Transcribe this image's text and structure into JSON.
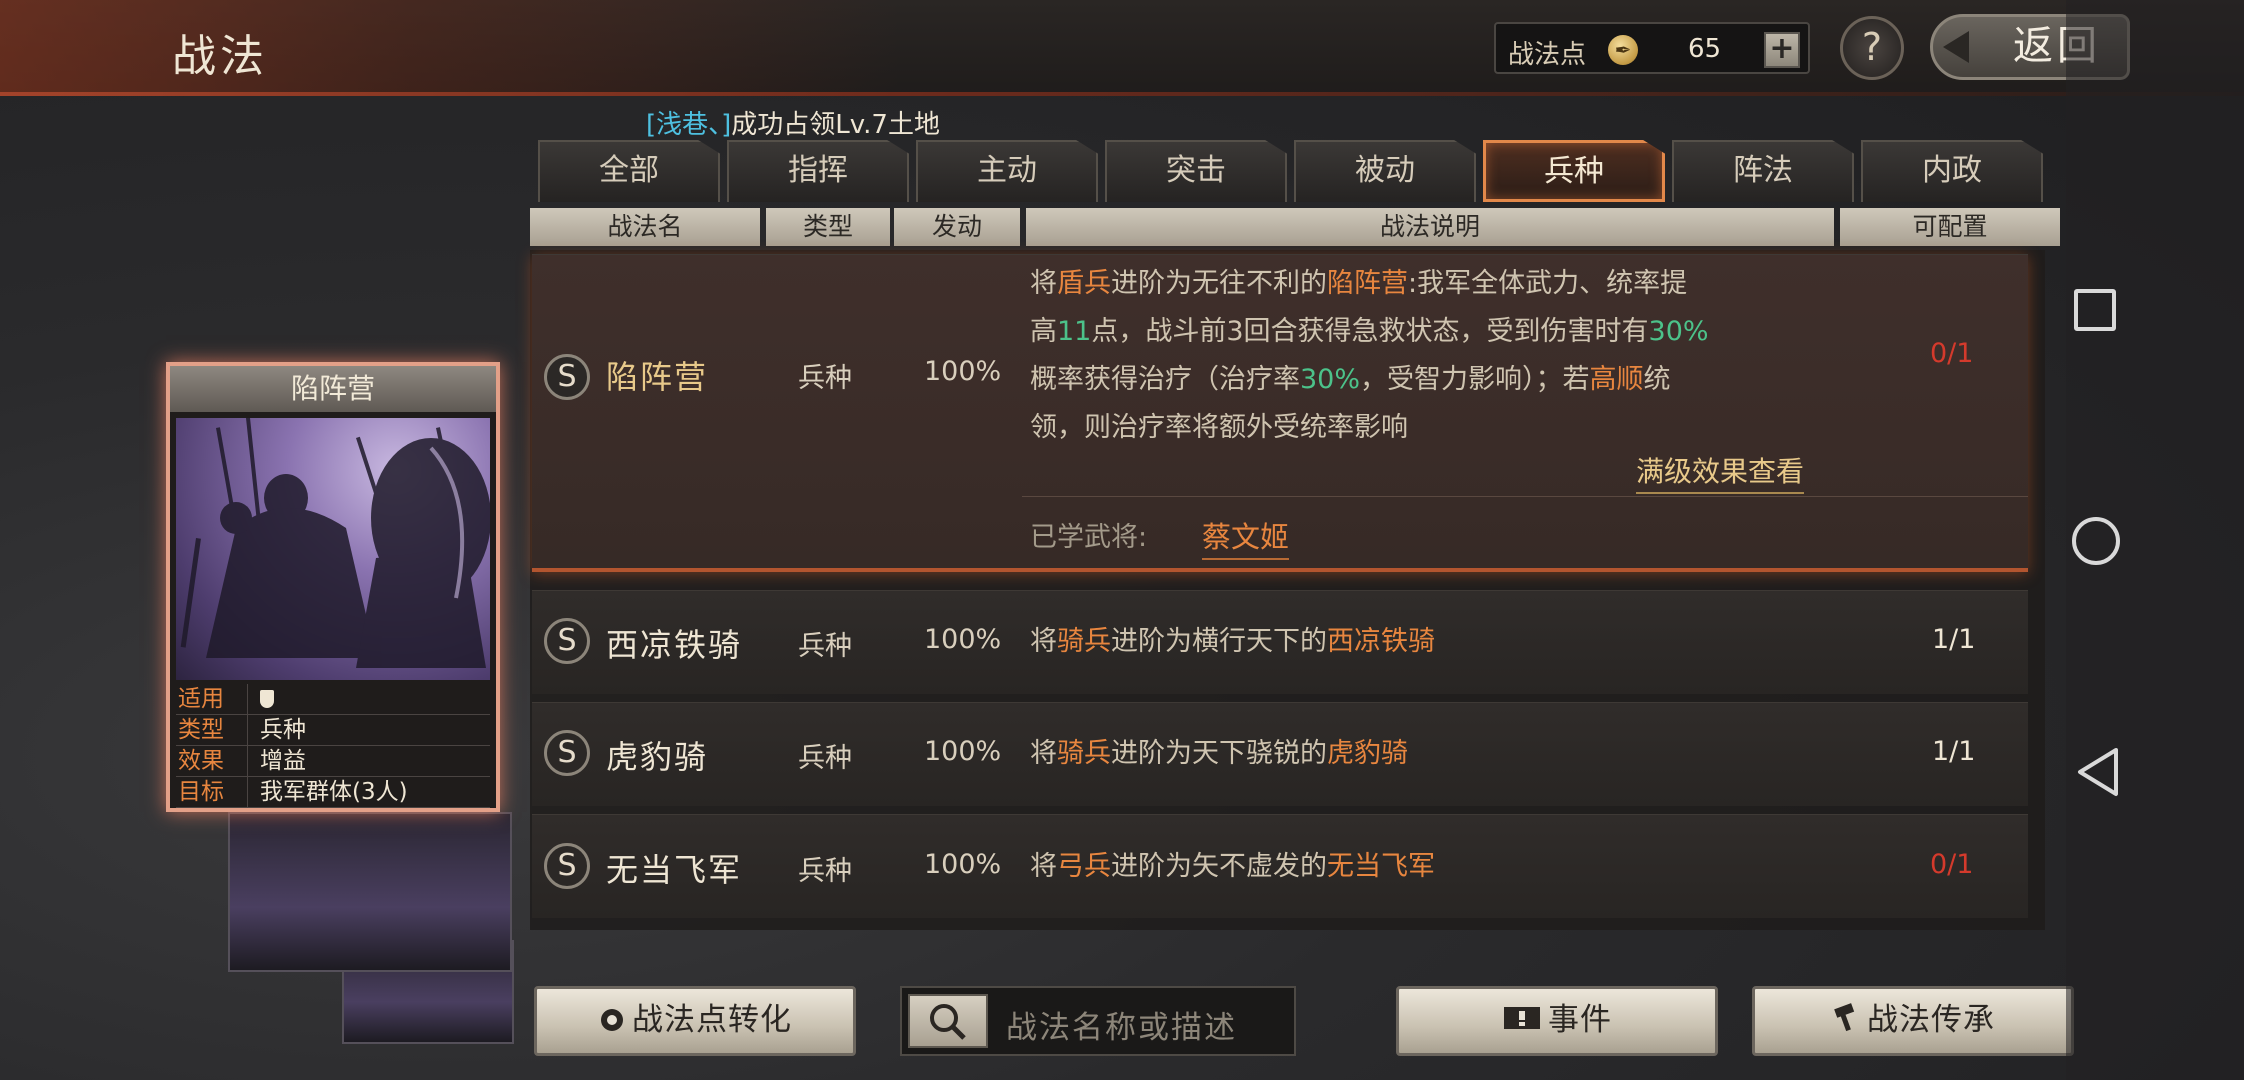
{
  "header": {
    "title": "战法",
    "points_label": "战法点",
    "points_value": "65",
    "plus_label": "+",
    "help_label": "?",
    "back_label": "返回"
  },
  "notice": {
    "who": "[浅巷、]",
    "text": "成功占领Lv.7土地"
  },
  "tabs": [
    {
      "label": "全部"
    },
    {
      "label": "指挥"
    },
    {
      "label": "主动"
    },
    {
      "label": "突击"
    },
    {
      "label": "被动"
    },
    {
      "label": "兵种",
      "active": true
    },
    {
      "label": "阵法"
    },
    {
      "label": "内政"
    }
  ],
  "columns": {
    "name": "战法名",
    "type": "类型",
    "rate": "发动",
    "desc": "战法说明",
    "config": "可配置"
  },
  "rows": [
    {
      "grade": "S",
      "name": "陷阵营",
      "type": "兵种",
      "rate": "100%",
      "config": "0/1",
      "desc_parts": [
        "将",
        "盾兵",
        "进阶为无往不利的",
        "陷阵营",
        ":我军全体武力、统率提",
        "高",
        "11",
        "点，战斗前3回合获得急救状态，受到伤害时有",
        "30%",
        "概率获得治疗（治疗率",
        "30%",
        "，受智力影响）；若",
        "高顺",
        "统",
        "领，则治疗率将额外受统率影响"
      ],
      "full_effect": "满级效果查看",
      "learned_label": "已学武将:",
      "learned_name": "蔡文姬"
    },
    {
      "grade": "S",
      "name": "西凉铁骑",
      "type": "兵种",
      "rate": "100%",
      "config": "1/1",
      "desc_parts": [
        "将",
        "骑兵",
        "进阶为横行天下的",
        "西凉铁骑"
      ]
    },
    {
      "grade": "S",
      "name": "虎豹骑",
      "type": "兵种",
      "rate": "100%",
      "config": "1/1",
      "desc_parts": [
        "将",
        "骑兵",
        "进阶为天下骁锐的",
        "虎豹骑"
      ]
    },
    {
      "grade": "S",
      "name": "无当飞军",
      "type": "兵种",
      "rate": "100%",
      "config": "0/1",
      "desc_parts": [
        "将",
        "弓兵",
        "进阶为矢不虚发的",
        "无当飞军"
      ]
    }
  ],
  "card": {
    "title": "陷阵营",
    "rows": [
      {
        "key": "适用",
        "value": ""
      },
      {
        "key": "类型",
        "value": "兵种"
      },
      {
        "key": "效果",
        "value": "增益"
      },
      {
        "key": "目标",
        "value": "我军群体(3人)"
      }
    ]
  },
  "bottom": {
    "convert_label": "战法点转化",
    "search_placeholder": "战法名称或描述",
    "event_label": "事件",
    "inherit_label": "战法传承"
  },
  "colors": {
    "accent_orange": "#e8863f",
    "accent_green": "#4cc28a",
    "alert_red": "#d43a2c",
    "tab_active_border": "#e2884a"
  }
}
